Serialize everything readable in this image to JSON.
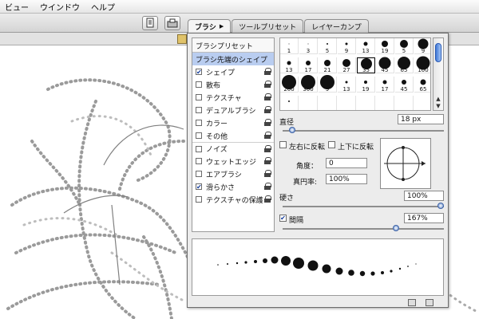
{
  "menubar": {
    "items": [
      "ビュー",
      "ウインドウ",
      "ヘルプ"
    ]
  },
  "tabs": [
    {
      "label": "ブラシ",
      "active": true
    },
    {
      "label": "ツールプリセット",
      "active": false
    },
    {
      "label": "レイヤーカンプ",
      "active": false
    }
  ],
  "brush_panel": {
    "preset_button": "ブラシプリセット",
    "sections": [
      {
        "label": "ブラシ先端のシェイプ",
        "checkable": false,
        "checked": false,
        "lock": false,
        "selected": true
      },
      {
        "label": "シェイプ",
        "checkable": true,
        "checked": true,
        "lock": true,
        "selected": false
      },
      {
        "label": "散布",
        "checkable": true,
        "checked": false,
        "lock": true,
        "selected": false
      },
      {
        "label": "テクスチャ",
        "checkable": true,
        "checked": false,
        "lock": true,
        "selected": false
      },
      {
        "label": "デュアルブラシ",
        "checkable": true,
        "checked": false,
        "lock": true,
        "selected": false
      },
      {
        "label": "カラー",
        "checkable": true,
        "checked": false,
        "lock": true,
        "selected": false
      },
      {
        "label": "その他",
        "checkable": true,
        "checked": false,
        "lock": true,
        "selected": false
      },
      {
        "label": "ノイズ",
        "checkable": true,
        "checked": false,
        "lock": true,
        "selected": false,
        "separator": true
      },
      {
        "label": "ウェットエッジ",
        "checkable": true,
        "checked": false,
        "lock": true,
        "selected": false
      },
      {
        "label": "エアブラシ",
        "checkable": true,
        "checked": false,
        "lock": true,
        "selected": false
      },
      {
        "label": "滑らかさ",
        "checkable": true,
        "checked": true,
        "lock": true,
        "selected": false
      },
      {
        "label": "テクスチャの保護",
        "checkable": true,
        "checked": false,
        "lock": true,
        "selected": false
      }
    ],
    "tips": [
      {
        "size": 1,
        "label": "1"
      },
      {
        "size": 3,
        "label": "3"
      },
      {
        "size": 5,
        "label": "5"
      },
      {
        "size": 9,
        "label": "9"
      },
      {
        "size": 13,
        "label": "13"
      },
      {
        "size": 19,
        "label": "19"
      },
      {
        "size": 5,
        "label": "5"
      },
      {
        "size": 9,
        "label": "9"
      },
      {
        "size": 13,
        "label": "13"
      },
      {
        "size": 17,
        "label": "17"
      },
      {
        "size": 21,
        "label": "21"
      },
      {
        "size": 27,
        "label": "27"
      },
      {
        "size": 35,
        "label": "35"
      },
      {
        "size": 45,
        "label": "45"
      },
      {
        "size": 65,
        "label": "65"
      },
      {
        "size": 100,
        "label": "100"
      },
      {
        "size": 200,
        "label": "200"
      },
      {
        "size": 300,
        "label": "300"
      },
      {
        "size": 9,
        "label": "9"
      },
      {
        "size": 13,
        "label": "13"
      },
      {
        "size": 19,
        "label": "19"
      },
      {
        "size": 17,
        "label": "17"
      },
      {
        "size": 45,
        "label": "45"
      },
      {
        "size": 65,
        "label": "65"
      }
    ],
    "visible_tip_labels": [
      "1",
      "3",
      "5",
      "9",
      "13",
      "19",
      "5",
      "9",
      "13",
      "17",
      "21",
      "27",
      "35",
      "45",
      "65",
      "100",
      "200",
      "300",
      "9",
      "13",
      "19",
      "17",
      "45",
      "65"
    ],
    "diameter_label": "直径",
    "diameter_value": "18 px",
    "diameter_fraction": 0.04,
    "flip_x_label": "左右に反転",
    "flip_y_label": "上下に反転",
    "angle_label": "角度：",
    "angle_value": "0",
    "roundness_label": "真円率:",
    "roundness_value": "100%",
    "hardness_label": "硬さ",
    "hardness_value": "100%",
    "hardness_fraction": 1.0,
    "spacing_label": "間隔",
    "spacing_checked": true,
    "spacing_value": "167%",
    "spacing_fraction": 0.71
  }
}
